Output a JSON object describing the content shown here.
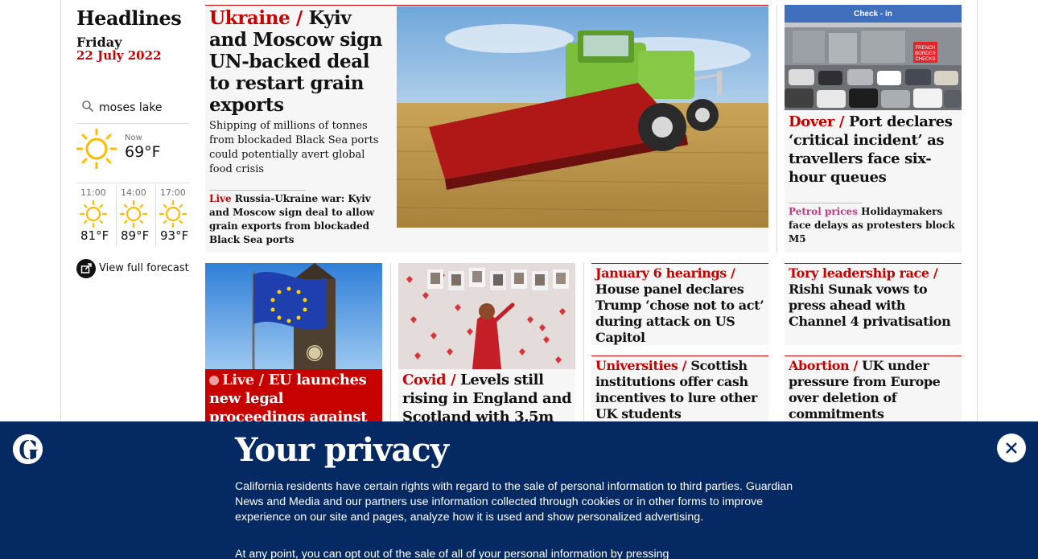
{
  "sidebar": {
    "title": "Headlines",
    "day": "Friday",
    "date": "22 July 2022",
    "weather": {
      "location": "moses lake",
      "now_label": "Now",
      "now_temp": "69°F",
      "now_icon": "sun-icon",
      "forecast": [
        {
          "time": "11:00",
          "temp": "81°F",
          "icon": "sun-icon"
        },
        {
          "time": "14:00",
          "temp": "89°F",
          "icon": "sun-icon"
        },
        {
          "time": "17:00",
          "temp": "93°F",
          "icon": "sun-icon"
        }
      ],
      "full_forecast_label": "View full forecast"
    }
  },
  "main_story": {
    "kicker": "Ukraine /",
    "headline": "Kyiv and Moscow sign UN-backed deal to restart grain exports",
    "standfirst": "Shipping of millions of tonnes from blockaded Black Sea ports could potentially avert global food crisis",
    "sublink_kicker": "Live",
    "sublink": "Russia-Ukraine war: Kyiv and Moscow sign deal to allow grain exports from blockaded Black Sea ports"
  },
  "dover_story": {
    "kicker": "Dover /",
    "headline": "Port declares ‘critical incident’ as travellers face six-hour queues",
    "image_sign": "Check - in",
    "image_board": "FRENCH BORDER CHECKS",
    "sublink_kicker": "Petrol prices",
    "sublink": "Holidaymakers face delays as protesters block M5"
  },
  "eu_story": {
    "kicker": "Live /",
    "headline": "EU launches new legal proceedings against UK over"
  },
  "covid_story": {
    "kicker": "Covid /",
    "headline": "Levels still rising in England and Scotland with 3.5m"
  },
  "jan6_story": {
    "kicker": "January 6 hearings /",
    "headline": "House panel declares Trump ‘chose not to act’ during attack on US Capitol"
  },
  "uni_story": {
    "kicker": "Universities /",
    "headline": "Scottish institutions offer cash incentives to lure other UK students"
  },
  "tory_story": {
    "kicker": "Tory leadership race /",
    "headline": "Rishi Sunak vows to press ahead with Channel 4 privatisation"
  },
  "abortion_story": {
    "kicker": "Abortion /",
    "headline": "UK under pressure from Europe over deletion of commitments"
  },
  "privacy": {
    "title": "Your privacy",
    "text": "California residents have certain rights with regard to the sale of personal information to third parties. Guardian News and Media and our partners use information collected through cookies or in other forms to improve experience on our site and pages, analyze how it is used and show personalized advertising.",
    "text2": "At any point, you can opt out of the sale of all of your personal information by pressing",
    "close_icon": "close-icon",
    "logo_icon": "guardian-logo-icon"
  },
  "colors": {
    "news_red": "#c70000",
    "lifestyle_pink": "#bb3b80",
    "brand_blue": "#052962",
    "card_bg": "#f6f6f6"
  }
}
